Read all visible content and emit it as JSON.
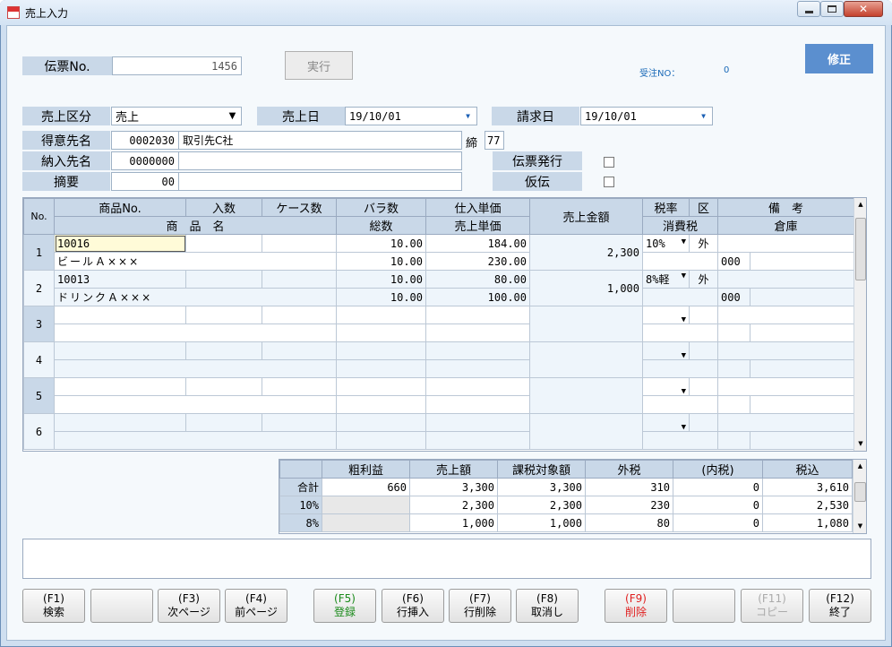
{
  "window": {
    "title": "売上入力"
  },
  "header": {
    "denpyo_label": "伝票No.",
    "denpyo_value": "1456",
    "run_label": "実行",
    "juchu_label": "受注NO：",
    "juchu_value": "0",
    "mode_label": "修正"
  },
  "form": {
    "uriage_kubun_label": "売上区分",
    "uriage_kubun_value": "売上",
    "uriage_bi_label": "売上日",
    "uriage_bi_value": "19/10/01",
    "seikyu_bi_label": "請求日",
    "seikyu_bi_value": "19/10/01",
    "tokuisaki_label": "得意先名",
    "tokuisaki_code": "0002030",
    "tokuisaki_name": "取引先C社",
    "shime_label": "締",
    "shime_value": "77",
    "nonyu_label": "納入先名",
    "nonyu_code": "0000000",
    "nonyu_name": "",
    "tekiyo_label": "摘要",
    "tekiyo_code": "00",
    "tekiyo_text": "",
    "denpyo_hakko_label": "伝票発行",
    "karaden_label": "仮伝"
  },
  "grid": {
    "headers_top": [
      "No.",
      "商品No.",
      "入数",
      "ケース数",
      "バラ数",
      "仕入単価",
      "売上金額",
      "税率",
      "区",
      "備　考"
    ],
    "headers_bottom": [
      "商　品　名",
      "総数",
      "売上単価",
      "消費税",
      "倉庫"
    ],
    "rows": [
      {
        "no": "1",
        "code": "10016",
        "name": "ビールＡ×××",
        "irisu": "",
        "case": "",
        "bara": "10.00",
        "sosu": "10.00",
        "shiire": "184.00",
        "uriage_tanka": "230.00",
        "kingaku": "2,300",
        "zeiritsu": "10%",
        "ku": "外",
        "biko": "",
        "soko": "000"
      },
      {
        "no": "2",
        "code": "10013",
        "name": "ドリンクＡ×××",
        "irisu": "",
        "case": "",
        "bara": "10.00",
        "sosu": "10.00",
        "shiire": "80.00",
        "uriage_tanka": "100.00",
        "kingaku": "1,000",
        "zeiritsu": "8%軽",
        "ku": "外",
        "biko": "",
        "soko": "000"
      },
      {
        "no": "3",
        "code": "",
        "name": "",
        "irisu": "",
        "case": "",
        "bara": "",
        "sosu": "",
        "shiire": "",
        "uriage_tanka": "",
        "kingaku": "",
        "zeiritsu": "",
        "ku": "",
        "biko": "",
        "soko": ""
      },
      {
        "no": "4",
        "code": "",
        "name": "",
        "irisu": "",
        "case": "",
        "bara": "",
        "sosu": "",
        "shiire": "",
        "uriage_tanka": "",
        "kingaku": "",
        "zeiritsu": "",
        "ku": "",
        "biko": "",
        "soko": ""
      },
      {
        "no": "5",
        "code": "",
        "name": "",
        "irisu": "",
        "case": "",
        "bara": "",
        "sosu": "",
        "shiire": "",
        "uriage_tanka": "",
        "kingaku": "",
        "zeiritsu": "",
        "ku": "",
        "biko": "",
        "soko": ""
      },
      {
        "no": "6",
        "code": "",
        "name": "",
        "irisu": "",
        "case": "",
        "bara": "",
        "sosu": "",
        "shiire": "",
        "uriage_tanka": "",
        "kingaku": "",
        "zeiritsu": "",
        "ku": "",
        "biko": "",
        "soko": ""
      }
    ]
  },
  "totals": {
    "headers": [
      "粗利益",
      "売上額",
      "課税対象額",
      "外税",
      "(内税)",
      "税込"
    ],
    "rows": [
      {
        "label": "合計",
        "values": [
          "660",
          "3,300",
          "3,300",
          "310",
          "0",
          "3,610"
        ]
      },
      {
        "label": "10%",
        "values": [
          "",
          "2,300",
          "2,300",
          "230",
          "0",
          "2,530"
        ]
      },
      {
        "label": "8%",
        "values": [
          "",
          "1,000",
          "1,000",
          "80",
          "0",
          "1,080"
        ]
      }
    ]
  },
  "fkeys": [
    {
      "key": "(F1)",
      "label": "検索"
    },
    {
      "key": "",
      "label": ""
    },
    {
      "key": "(F3)",
      "label": "次ページ"
    },
    {
      "key": "(F4)",
      "label": "前ページ"
    },
    {
      "key": "(F5)",
      "label": "登録"
    },
    {
      "key": "(F6)",
      "label": "行挿入"
    },
    {
      "key": "(F7)",
      "label": "行削除"
    },
    {
      "key": "(F8)",
      "label": "取消し"
    },
    {
      "key": "(F9)",
      "label": "削除"
    },
    {
      "key": "",
      "label": ""
    },
    {
      "key": "(F11)",
      "label": "コピー"
    },
    {
      "key": "(F12)",
      "label": "終了"
    }
  ],
  "colors": {
    "accent": "#5b8fcf",
    "f5": "#1a8a1a",
    "f9": "#e02020",
    "label_bg": "#c9d8e8"
  }
}
